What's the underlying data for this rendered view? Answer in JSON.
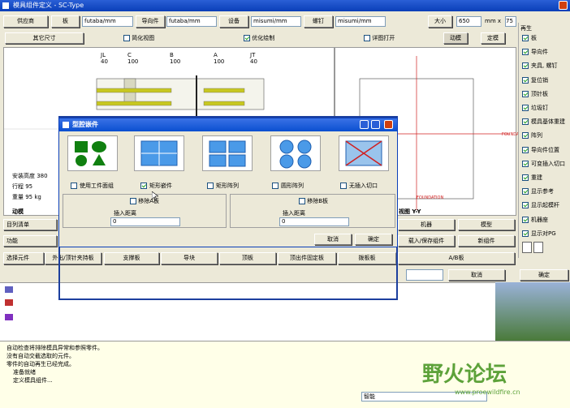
{
  "window": {
    "title": "模具组件定义 - SC-Type"
  },
  "top_row": {
    "supplier_label": "供应商",
    "supplier_value": "futaba/mm",
    "plate_label": "板",
    "plate_value": "futaba/mm",
    "guide_label": "导向件",
    "guide_value": "futaba/mm",
    "device_label": "设备",
    "device_value": "misumi/mm",
    "screw_label": "螺钉",
    "screw_value": "misumi/mm",
    "size_label": "大小",
    "size_value": "650",
    "unit": "mm x",
    "size_value2": "75"
  },
  "second_row": {
    "other_size": "其它尺寸",
    "simplify_label": "简化视图",
    "simplify_checked": false,
    "optimize_label": "优化绘制",
    "optimize_checked": true,
    "detail_label": "详图打开",
    "detail_checked": false,
    "move_button": "动模",
    "fixed_button": "定模"
  },
  "section_labels": [
    {
      "code": "JL",
      "value": "40"
    },
    {
      "code": "C",
      "value": "100"
    },
    {
      "code": "B",
      "value": "100"
    },
    {
      "code": "A",
      "value": "100"
    },
    {
      "code": "JT",
      "value": "40"
    }
  ],
  "info": {
    "height": "安装高度 380",
    "stroke": "行程 95",
    "weight": "重量 95 kg",
    "moving": "动模"
  },
  "view_right": {
    "x_axis": "FOUNDATION",
    "y_label": "FOUNDATION",
    "view_label": "视图 Y-Y"
  },
  "right_panel": {
    "title": "再生",
    "items": [
      {
        "label": "板",
        "checked": true
      },
      {
        "label": "导向件",
        "checked": true
      },
      {
        "label": "夹具, 螺钉",
        "checked": true
      },
      {
        "label": "复位销",
        "checked": true
      },
      {
        "label": "顶针板",
        "checked": true
      },
      {
        "label": "垃圾钉",
        "checked": true
      },
      {
        "label": "模具基体重建",
        "checked": true
      },
      {
        "label": "阵列",
        "checked": true
      },
      {
        "label": "导向件位置",
        "checked": true
      },
      {
        "label": "可变插入切口",
        "checked": true
      },
      {
        "label": "重建",
        "checked": true
      },
      {
        "label": "显示参考",
        "checked": true
      },
      {
        "label": "显示起模杆",
        "checked": true
      },
      {
        "label": "机器座",
        "checked": true
      },
      {
        "label": "显示对PG",
        "checked": true
      }
    ]
  },
  "bottom_rows": {
    "row1_left": "目列清单",
    "row1_right": [
      "机器",
      "模型"
    ],
    "row2_left": "功能",
    "row2_right": [
      "载入/保存组件",
      "新组件"
    ],
    "row3": [
      "选择元件",
      "外出/顶针夹持板",
      "支撑板",
      "导块",
      "顶板",
      "顶出件固定板",
      "拨板板"
    ],
    "row3_right": "A/B板",
    "cancel": "取消",
    "ok": "确定"
  },
  "dialog": {
    "title": "型腔嵌件",
    "options": [
      {
        "label": "使用工件面组",
        "checked": false
      },
      {
        "label": "矩形嵌件",
        "checked": true
      },
      {
        "label": "矩形阵列",
        "checked": false
      },
      {
        "label": "圆形阵列",
        "checked": false
      },
      {
        "label": "无插入切口",
        "checked": false
      }
    ],
    "left_group": {
      "check_label": "移除A板",
      "field_label": "插入距离",
      "value": "0"
    },
    "right_group": {
      "check_label": "移除B板",
      "field_label": "插入距离",
      "value": "0"
    },
    "cancel": "取消",
    "ok": "确定"
  },
  "messages": [
    "自动检查将排除模具异常和参照零件。",
    "没有自动交截选取的元件。",
    "零件的自动再生已经完成。",
    "准备就绪",
    "定义模具组件..."
  ],
  "status_select": "智能",
  "watermark": {
    "text": "野火论坛",
    "url": "www.proewildfire.cn"
  },
  "colors": {
    "accent": "#0a3fb8",
    "dialog_frame": "#1c3f9e",
    "checkmark": "#21a121"
  }
}
